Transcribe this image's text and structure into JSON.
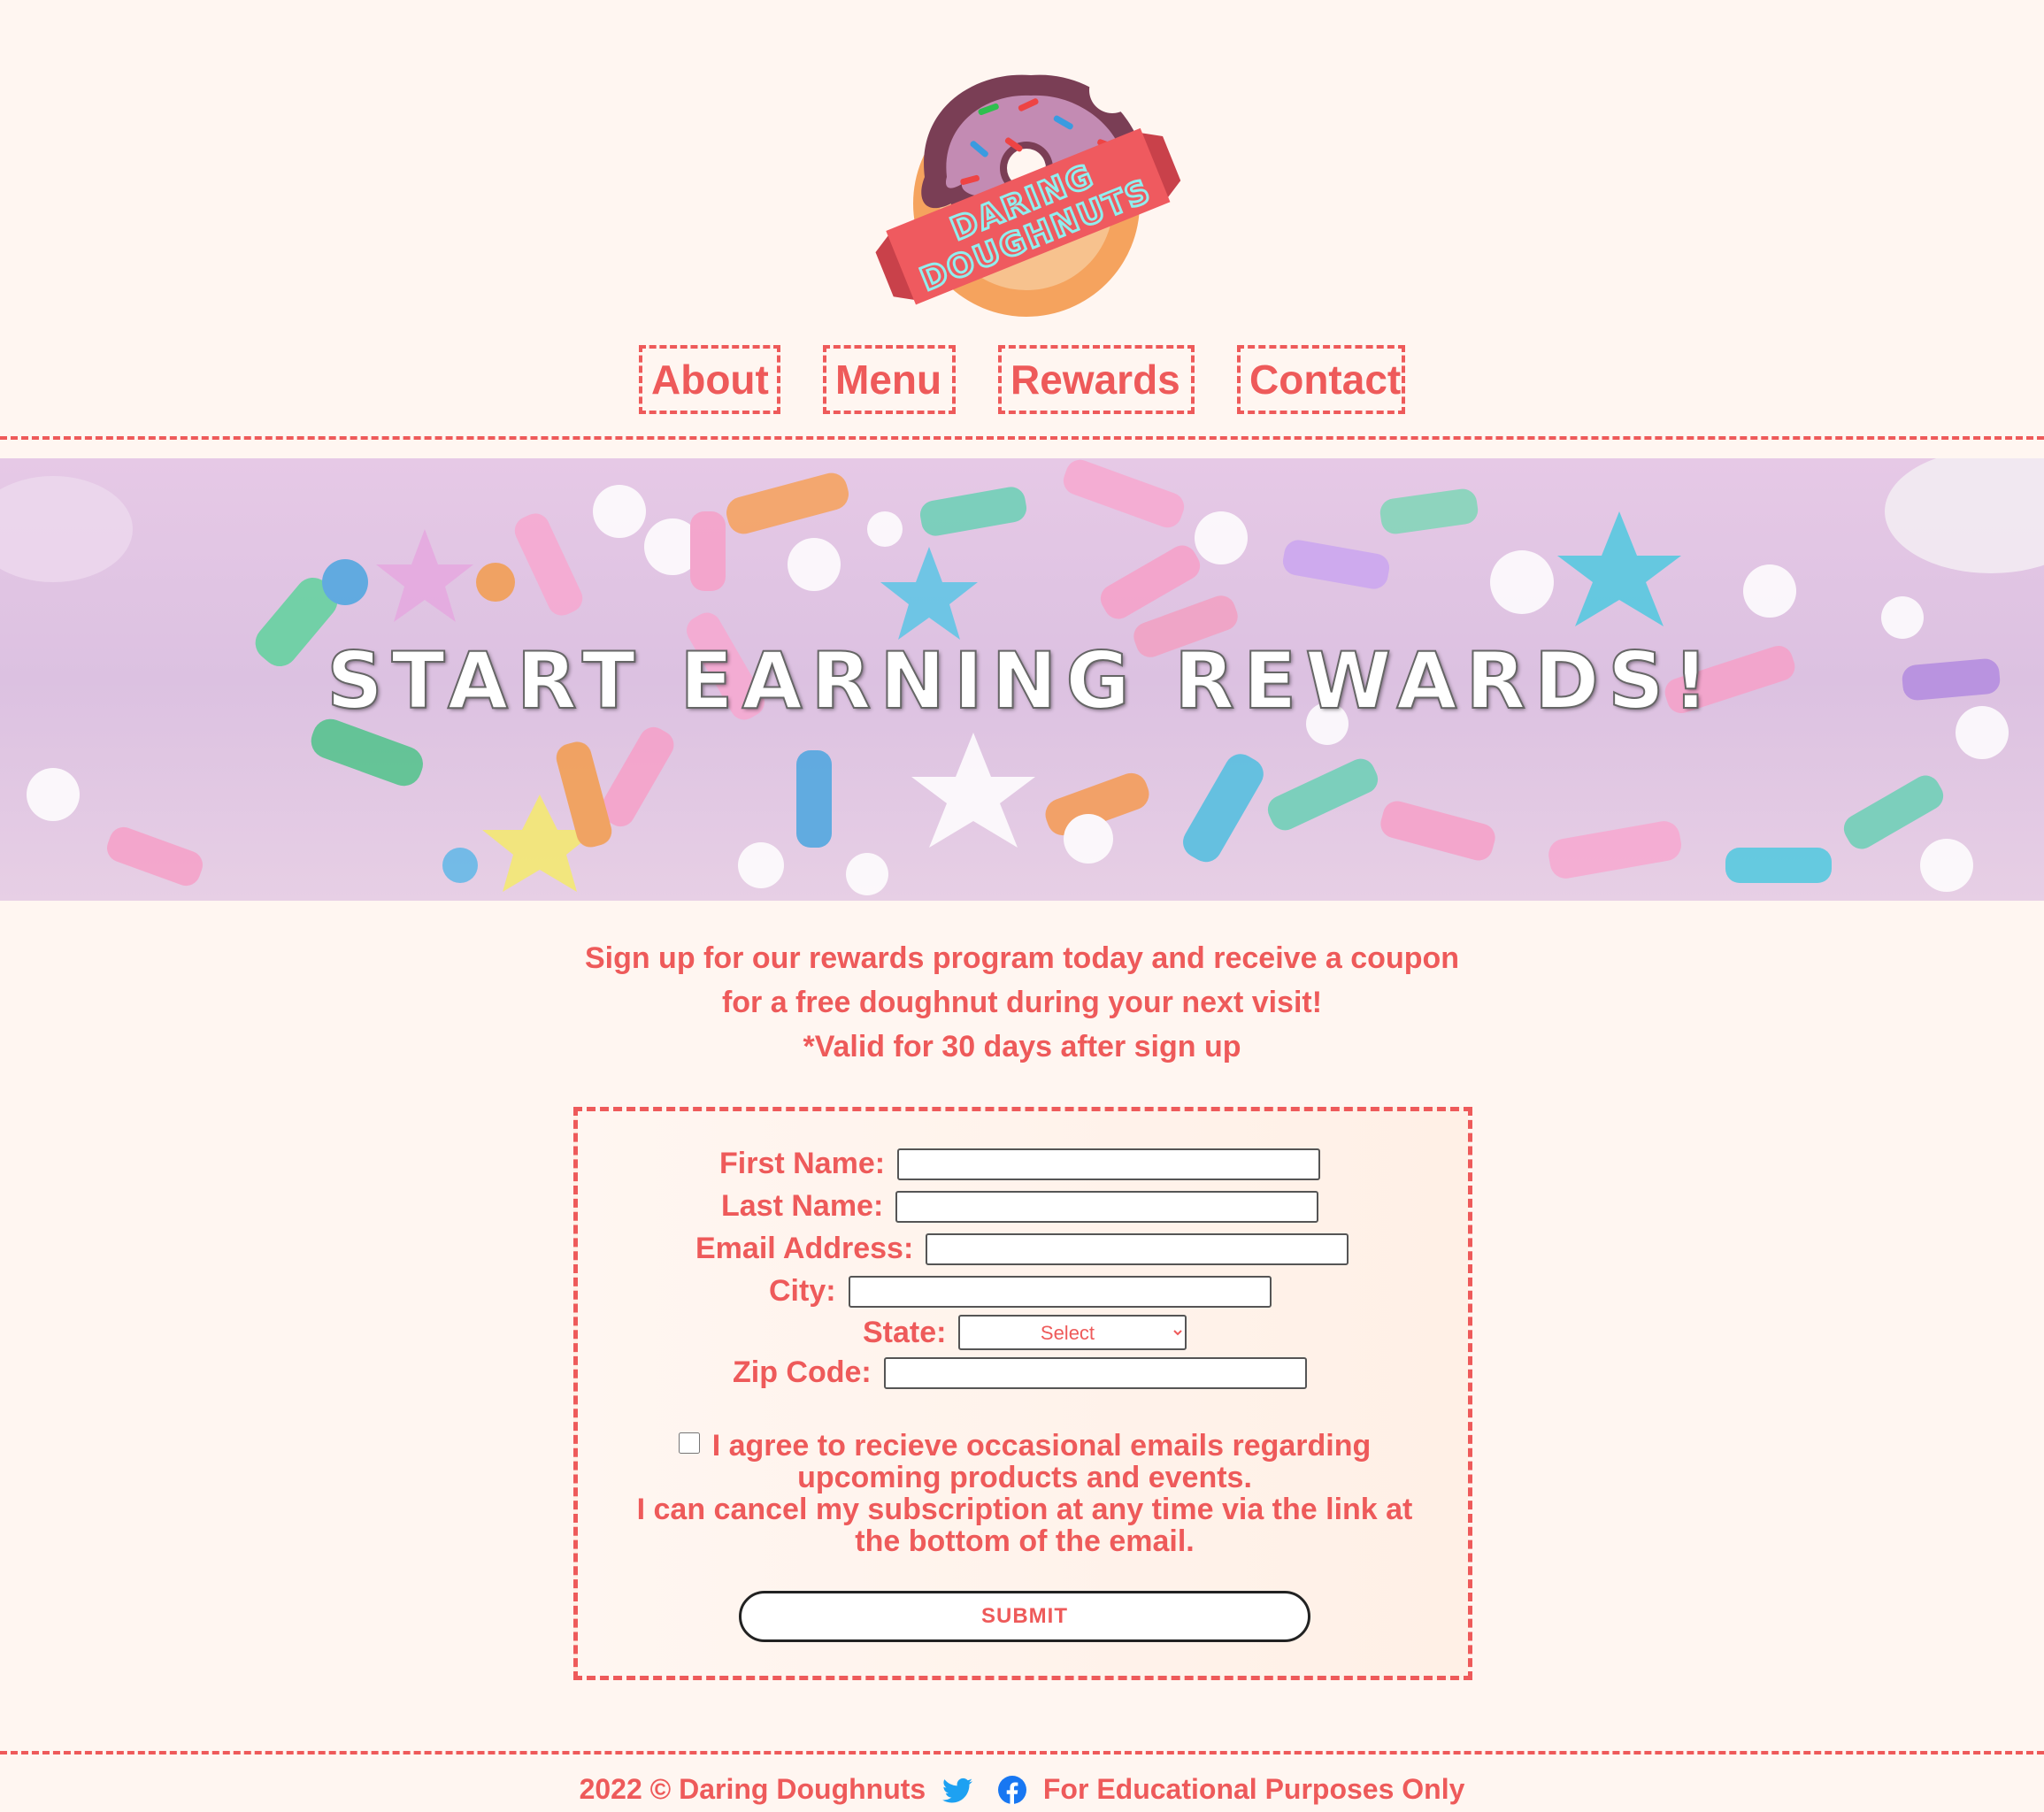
{
  "logo": {
    "line1": "DARING",
    "line2": "DOUGHNUTS"
  },
  "nav": {
    "items": [
      "About",
      "Menu",
      "Rewards",
      "Contact"
    ]
  },
  "hero": {
    "title": "Start Earning Rewards!"
  },
  "intro": {
    "line1": "Sign up for our rewards program today and receive a coupon",
    "line2": "for a free doughnut during your next visit!",
    "line3": "*Valid for 30 days after sign up"
  },
  "form": {
    "first_name_label": "First Name:",
    "last_name_label": "Last Name:",
    "email_label": "Email Address:",
    "city_label": "City:",
    "state_label": "State:",
    "state_selected": "Select",
    "zip_label": "Zip Code:",
    "agree_line1": "I agree to recieve occasional emails regarding",
    "agree_line2": "upcoming products and events.",
    "agree_line3": "I can cancel my subscription at any time via the link at",
    "agree_line4": "the bottom of the email.",
    "submit_label": "SUBMIT"
  },
  "footer": {
    "copyright": "2022 © Daring Doughnuts",
    "disclaimer": "For Educational Purposes Only",
    "icons": [
      "twitter-icon",
      "facebook-icon"
    ]
  },
  "colors": {
    "accent": "#ee5a5a",
    "background": "#fff6f1",
    "twitter": "#1da1f2",
    "facebook": "#1877f2"
  }
}
